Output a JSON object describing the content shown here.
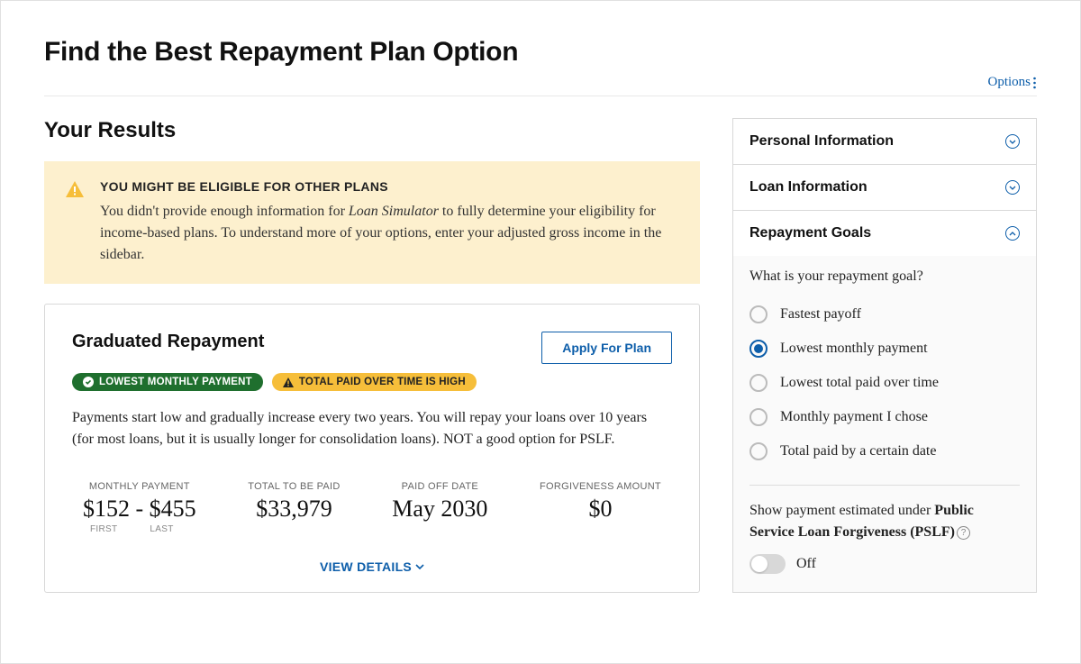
{
  "page_title": "Find the Best Repayment Plan Option",
  "options_link": "Options",
  "results_title": "Your Results",
  "alert": {
    "title": "YOU MIGHT BE ELIGIBLE FOR OTHER PLANS",
    "body_before": "You didn't provide enough information for ",
    "body_em": "Loan Simulator",
    "body_after": " to fully determine your eligibility for income-based plans. To understand more of your options, enter your adjusted gross income in the sidebar."
  },
  "plan": {
    "name": "Graduated Repayment",
    "apply_label": "Apply For Plan",
    "badge_green": "LOWEST MONTHLY PAYMENT",
    "badge_yellow": "TOTAL PAID OVER TIME IS HIGH",
    "description": "Payments start low and gradually increase every two years. You will repay your loans over 10 years (for most loans, but it is usually longer for consolidation loans). NOT a good option for PSLF.",
    "stats": {
      "monthly_label": "MONTHLY PAYMENT",
      "monthly_value": "$152 - $455",
      "monthly_first": "FIRST",
      "monthly_last": "LAST",
      "total_label": "TOTAL TO BE PAID",
      "total_value": "$33,979",
      "paidoff_label": "PAID OFF DATE",
      "paidoff_value": "May 2030",
      "forgiveness_label": "FORGIVENESS AMOUNT",
      "forgiveness_value": "$0"
    },
    "view_details": "VIEW DETAILS"
  },
  "sidebar": {
    "accordion": {
      "personal": "Personal Information",
      "loan": "Loan Information",
      "goals": "Repayment Goals"
    },
    "goal_question": "What is your repayment goal?",
    "goals": [
      "Fastest payoff",
      "Lowest monthly payment",
      "Lowest total paid over time",
      "Monthly payment I chose",
      "Total paid by a certain date"
    ],
    "selected_goal_index": 1,
    "pslf_pre": "Show payment estimated under ",
    "pslf_bold": "Public Service Loan Forgiveness (PSLF)",
    "toggle_state": "Off"
  }
}
